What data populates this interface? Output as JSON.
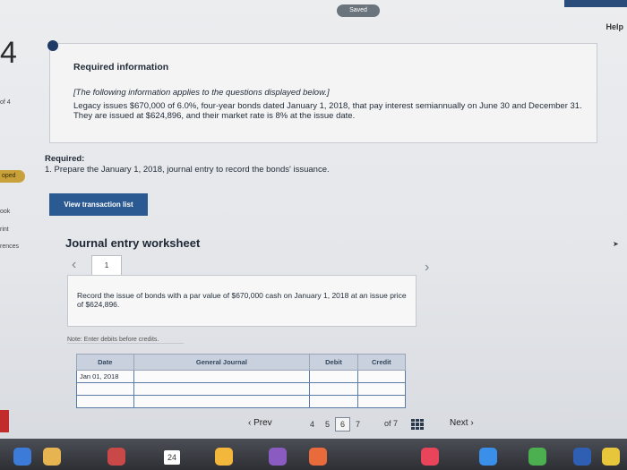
{
  "header": {
    "saved_badge": "Saved",
    "help_label": "Help"
  },
  "sidebar": {
    "question_number": "4",
    "labels": [
      {
        "text": "of 4"
      },
      {
        "text": "oped"
      },
      {
        "text": "ook"
      },
      {
        "text": "rint"
      },
      {
        "text": "rences"
      }
    ]
  },
  "info": {
    "title": "Required information",
    "subtitle": "[The following information applies to the questions displayed below.]",
    "text": "Legacy issues $670,000 of 6.0%, four-year bonds dated January 1, 2018, that pay interest semiannually on June 30 and December 31. They are issued at $624,896, and their market rate is 8% at the issue date."
  },
  "required": {
    "label": "Required:",
    "text": "1. Prepare the January 1, 2018, journal entry to record the bonds' issuance."
  },
  "view_transaction_list_label": "View transaction list",
  "worksheet": {
    "title": "Journal entry worksheet",
    "current_tab": "1",
    "instruction": "Record the issue of bonds with a par value of $670,000 cash on January 1, 2018 at an issue price of $624,896.",
    "note": "Note: Enter debits before credits.",
    "columns": [
      "Date",
      "General Journal",
      "Debit",
      "Credit"
    ],
    "rows": [
      {
        "date": "Jan 01, 2018",
        "account": "",
        "debit": "",
        "credit": ""
      },
      {
        "date": "",
        "account": "",
        "debit": "",
        "credit": ""
      },
      {
        "date": "",
        "account": "",
        "debit": "",
        "credit": ""
      }
    ]
  },
  "navigation": {
    "prev_label": "Prev",
    "pages": [
      "4",
      "5",
      "6",
      "7"
    ],
    "active_page": "6",
    "of_label": "of 7",
    "next_label": "Next"
  },
  "dock": {
    "date": "24"
  },
  "colors": {
    "primary_button": "#2a5a91",
    "info_dot": "#1f3a64",
    "helped_tag": "#c9a13a",
    "table_border": "#5a7aa8"
  }
}
